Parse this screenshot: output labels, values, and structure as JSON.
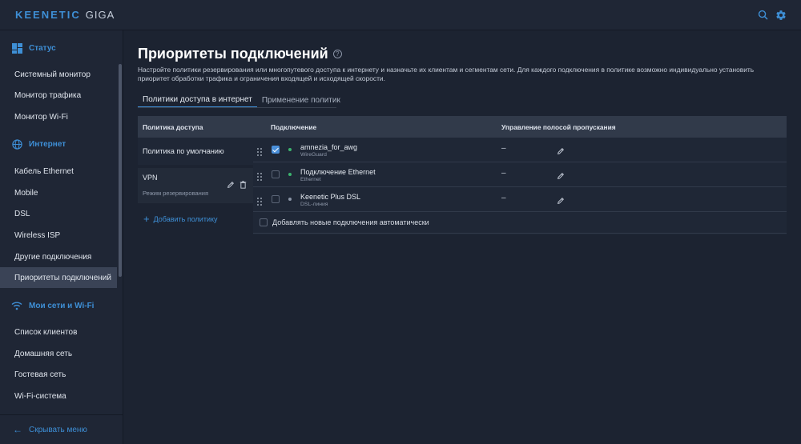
{
  "brand": {
    "name": "KEENETIC",
    "model": "GIGA"
  },
  "top_icons": [
    "search-icon",
    "gear-icon"
  ],
  "sidebar": {
    "sections": [
      {
        "title": "Статус",
        "icon": "dashboard-icon",
        "items": [
          "Системный монитор",
          "Монитор трафика",
          "Монитор Wi-Fi"
        ]
      },
      {
        "title": "Интернет",
        "icon": "globe-icon",
        "items": [
          "Кабель Ethernet",
          "Mobile",
          "DSL",
          "Wireless ISP",
          "Другие подключения",
          "Приоритеты подключений"
        ]
      },
      {
        "title": "Мои сети и Wi-Fi",
        "icon": "wifi-icon",
        "items": [
          "Список клиентов",
          "Домашняя сеть",
          "Гостевая сеть",
          "Wi-Fi-система"
        ]
      }
    ],
    "active_item": "Приоритеты подключений",
    "collapse_label": "Скрывать меню"
  },
  "main": {
    "title": "Приоритеты подключений",
    "description": "Настройте политики резервирования или многопутевого доступа к интернету и назначьте их клиентам и сегментам сети. Для каждого подключения в политике возможно индивидуально установить приоритет обработки трафика и ограничения входящей и исходящей скорости.",
    "tabs": [
      {
        "label": "Политики доступа в интернет",
        "active": true
      },
      {
        "label": "Применение политик",
        "active": false
      }
    ],
    "table": {
      "headers": {
        "policy": "Политика доступа",
        "connection": "Подключение",
        "bandwidth": "Управление полосой пропускания"
      },
      "policies": [
        {
          "name": "Политика по умолчанию",
          "sub": ""
        },
        {
          "name": "VPN",
          "sub": "Режим резервирования"
        }
      ],
      "add_policy_label": "Добавить политику",
      "connections": [
        {
          "name": "amnezia_for_awg",
          "type": "WireGuard",
          "checked": true,
          "status_color": "#3cb46e",
          "bandwidth": "–"
        },
        {
          "name": "Подключение Ethernet",
          "type": "Ethernet",
          "checked": false,
          "status_color": "#3cb46e",
          "bandwidth": "–"
        },
        {
          "name": "Keenetic Plus DSL",
          "type": "DSL-линия",
          "checked": false,
          "status_color": "#8b95a7",
          "bandwidth": "–"
        }
      ],
      "auto_add_label": "Добавлять новые подключения автоматически"
    }
  },
  "colors": {
    "accent": "#3e8fd6",
    "background": "#1c2331",
    "sidebar": "#1f2635"
  }
}
